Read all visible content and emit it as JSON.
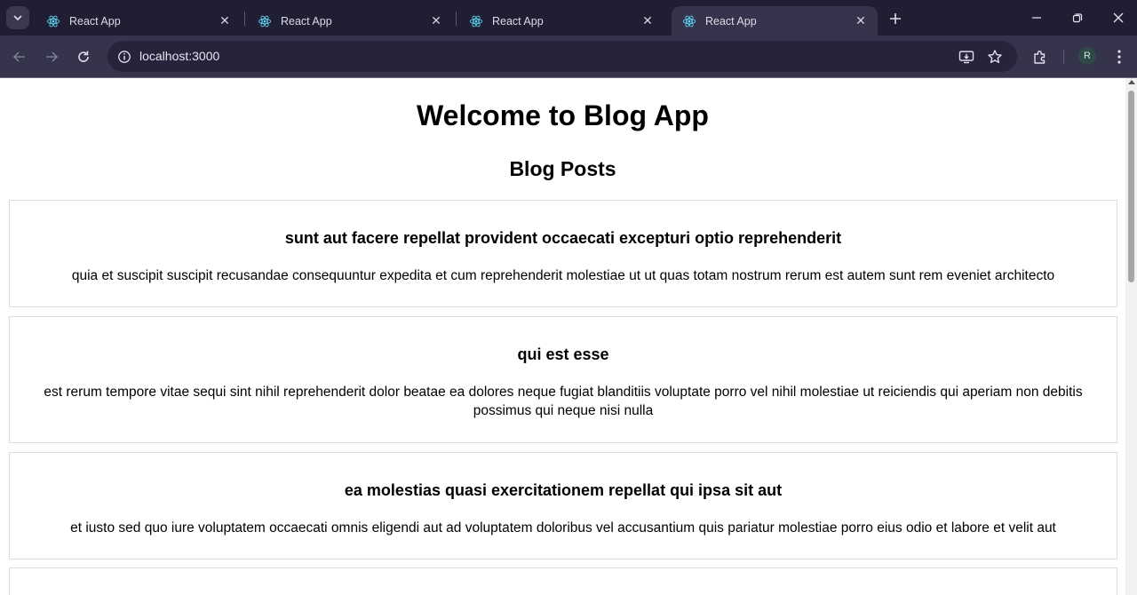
{
  "browser": {
    "tabs": [
      {
        "title": "React App",
        "active": false
      },
      {
        "title": "React App",
        "active": false
      },
      {
        "title": "React App",
        "active": false
      },
      {
        "title": "React App",
        "active": true
      }
    ],
    "url": "localhost:3000",
    "profile_initial": "R",
    "colors": {
      "tabstrip": "#1f1e33",
      "toolbar": "#35344c",
      "omnibox": "#25243a",
      "react": "#61dafb"
    }
  },
  "page": {
    "title": "Welcome to Blog App",
    "section_title": "Blog Posts",
    "posts": [
      {
        "title": "sunt aut facere repellat provident occaecati excepturi optio reprehenderit",
        "body": "quia et suscipit suscipit recusandae consequuntur expedita et cum reprehenderit molestiae ut ut quas totam nostrum rerum est autem sunt rem eveniet architecto"
      },
      {
        "title": "qui est esse",
        "body": "est rerum tempore vitae sequi sint nihil reprehenderit dolor beatae ea dolores neque fugiat blanditiis voluptate porro vel nihil molestiae ut reiciendis qui aperiam non debitis possimus qui neque nisi nulla"
      },
      {
        "title": "ea molestias quasi exercitationem repellat qui ipsa sit aut",
        "body": "et iusto sed quo iure voluptatem occaecati omnis eligendi aut ad voluptatem doloribus vel accusantium quis pariatur molestiae porro eius odio et labore et velit aut"
      }
    ]
  }
}
